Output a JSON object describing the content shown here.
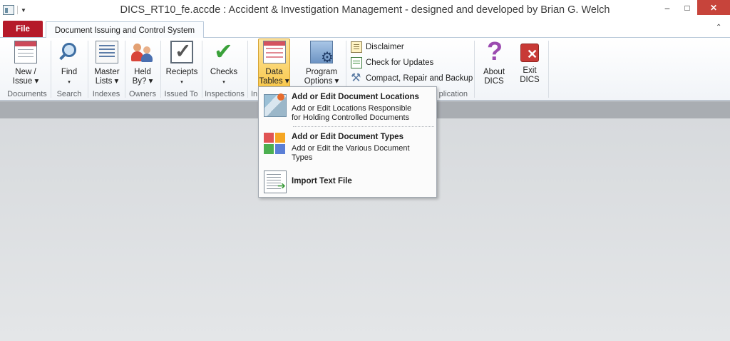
{
  "window": {
    "title": "DICS_RT10_fe.accde : Accident & Investigation Management - designed and developed by Brian G. Welch",
    "minimize": "–",
    "maximize": "□",
    "close": "✕"
  },
  "tabs": {
    "file": "File",
    "active": "Document Issuing and Control System",
    "collapse": "⌃",
    "help": "?"
  },
  "ribbon": {
    "groups": [
      {
        "label": "Documents",
        "buttons": [
          {
            "line1": "New /",
            "line2": "Issue ▾"
          }
        ]
      },
      {
        "label": "Search",
        "buttons": [
          {
            "line1": "Find",
            "line2": "▾"
          }
        ]
      },
      {
        "label": "Indexes",
        "buttons": [
          {
            "line1": "Master",
            "line2": "Lists ▾"
          }
        ]
      },
      {
        "label": "Owners",
        "buttons": [
          {
            "line1": "Held",
            "line2": "By? ▾"
          }
        ]
      },
      {
        "label": "Issued To",
        "buttons": [
          {
            "line1": "Reciepts",
            "line2": "▾"
          }
        ]
      },
      {
        "label": "Inspections",
        "buttons": [
          {
            "line1": "Checks",
            "line2": "▾"
          }
        ]
      },
      {
        "label": "In",
        "buttons": [
          {
            "line1": "Data",
            "line2": "Tables ▾"
          },
          {
            "line1": "Program",
            "line2": "Options ▾"
          }
        ]
      },
      {
        "label": "plication",
        "small": [
          "Disclaimer",
          "Check for Updates",
          "Compact, Repair and Backup"
        ]
      },
      {
        "label": "",
        "buttons": [
          {
            "line1": "About",
            "line2": "DICS"
          },
          {
            "line1": "Exit",
            "line2": "DICS"
          }
        ]
      }
    ]
  },
  "menu": {
    "items": [
      {
        "title": "Add or Edit Document Locations",
        "desc1": "Add or Edit Locations Responsible",
        "desc2": "for Holding Controlled Documents"
      },
      {
        "title": "Add or Edit Document Types",
        "desc1": "Add or Edit the Various Document",
        "desc2": "Types"
      },
      {
        "title": "Import Text File"
      }
    ]
  },
  "icons": {
    "new_issue": "new-issue-icon",
    "find": "find-icon",
    "master_lists": "master-lists-icon",
    "held_by": "owners-icon",
    "reciepts": "reciepts-icon",
    "checks": "checks-icon",
    "data_tables": "data-tables-icon",
    "program_options": "program-options-icon",
    "disclaimer": "disclaimer-icon",
    "check_updates": "check-updates-icon",
    "compact": "compact-repair-icon",
    "about": "about-icon",
    "exit": "exit-icon"
  },
  "colors": {
    "file_tab": "#b51a2a",
    "active_button": "#f9c94d",
    "close_button": "#c7443b"
  }
}
